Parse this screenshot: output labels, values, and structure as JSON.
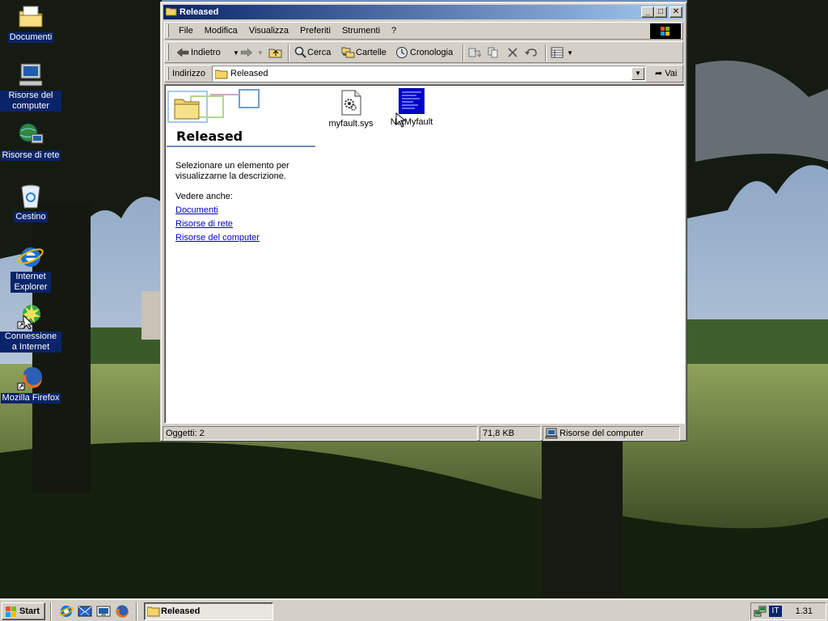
{
  "desktop": {
    "icons": [
      {
        "label": "Documenti"
      },
      {
        "label": "Risorse del computer"
      },
      {
        "label": "Risorse di rete"
      },
      {
        "label": "Cestino"
      },
      {
        "label": "Internet Explorer"
      },
      {
        "label": "Connessione a Internet"
      },
      {
        "label": "Mozilla Firefox"
      }
    ]
  },
  "window": {
    "title": "Released",
    "controls": {
      "minimize": "_",
      "maximize": "□",
      "close": "✕"
    },
    "menu": [
      "File",
      "Modifica",
      "Visualizza",
      "Preferiti",
      "Strumenti",
      "?"
    ],
    "toolbar": {
      "back": "Indietro",
      "search": "Cerca",
      "folders": "Cartelle",
      "history": "Cronologia"
    },
    "address": {
      "label": "Indirizzo",
      "value": "Released",
      "go": "Vai"
    },
    "side_panel": {
      "title": "Released",
      "description": "Selezionare un elemento per visualizzarne la descrizione.",
      "see_also": "Vedere anche:",
      "links": [
        "Documenti",
        "Risorse di rete",
        "Risorse del computer"
      ]
    },
    "files": [
      {
        "name": "myfault.sys",
        "type": "system-file"
      },
      {
        "name": "NotMyfault",
        "type": "application"
      }
    ],
    "status": {
      "objects": "Oggetti: 2",
      "size": "71,8 KB",
      "zone": "Risorse del computer"
    }
  },
  "taskbar": {
    "start": "Start",
    "tasks": [
      {
        "label": "Released"
      }
    ],
    "language": "IT",
    "clock": "1.31"
  },
  "colors": {
    "title_active": "#0a246a",
    "title_gradient_end": "#a6caf0",
    "face": "#d4d0c8",
    "selection": "#0a246a",
    "link": "#0000cc"
  }
}
